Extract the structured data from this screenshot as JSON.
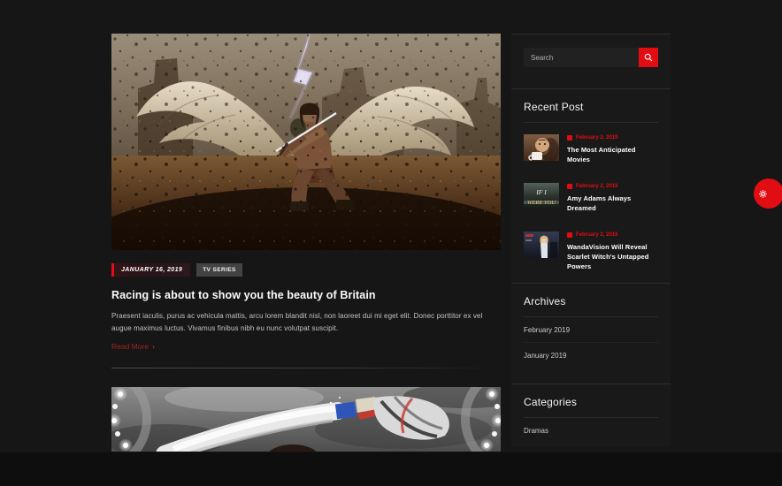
{
  "colors": {
    "accent": "#e20d13",
    "page_bg": "#151515",
    "section_bg": "#161616",
    "footer_bg": "#0e0e0e",
    "widget_bg": "#191919",
    "read_more": "#a02424",
    "body_text": "#c4c4c4"
  },
  "search": {
    "placeholder": "Search"
  },
  "sidebar": {
    "recent": {
      "title": "Recent Post",
      "items": [
        {
          "date": "February 2, 2019",
          "title": "The Most Anticipated Movies"
        },
        {
          "date": "February 2, 2019",
          "title": "Amy Adams Always Dreamed",
          "thumb_text_line1": "IF I",
          "thumb_text_line2": "WERE YOU"
        },
        {
          "date": "February 2, 2019",
          "title": "WandaVision Will Reveal Scarlet Witch's Untapped Powers"
        }
      ]
    },
    "archives": {
      "title": "Archives",
      "items": [
        "February 2019",
        "January 2019"
      ]
    },
    "categories": {
      "title": "Categories",
      "items": [
        "Dramas"
      ]
    }
  },
  "main": {
    "post1": {
      "date": "JANUARY 16, 2019",
      "category": "TV SERIES",
      "title": "Racing is about to show you the beauty of Britain",
      "excerpt": "Praesent iaculis, purus ac vehicula mattis, arcu lorem blandit nisl, non laoreet dui mi eget elit. Donec porttitor ex vel augue maximus luctus. Vivamus finibus nibh eu nunc volutpat suscipit.",
      "read_more": "Read More",
      "read_more_arrow": "›"
    }
  }
}
